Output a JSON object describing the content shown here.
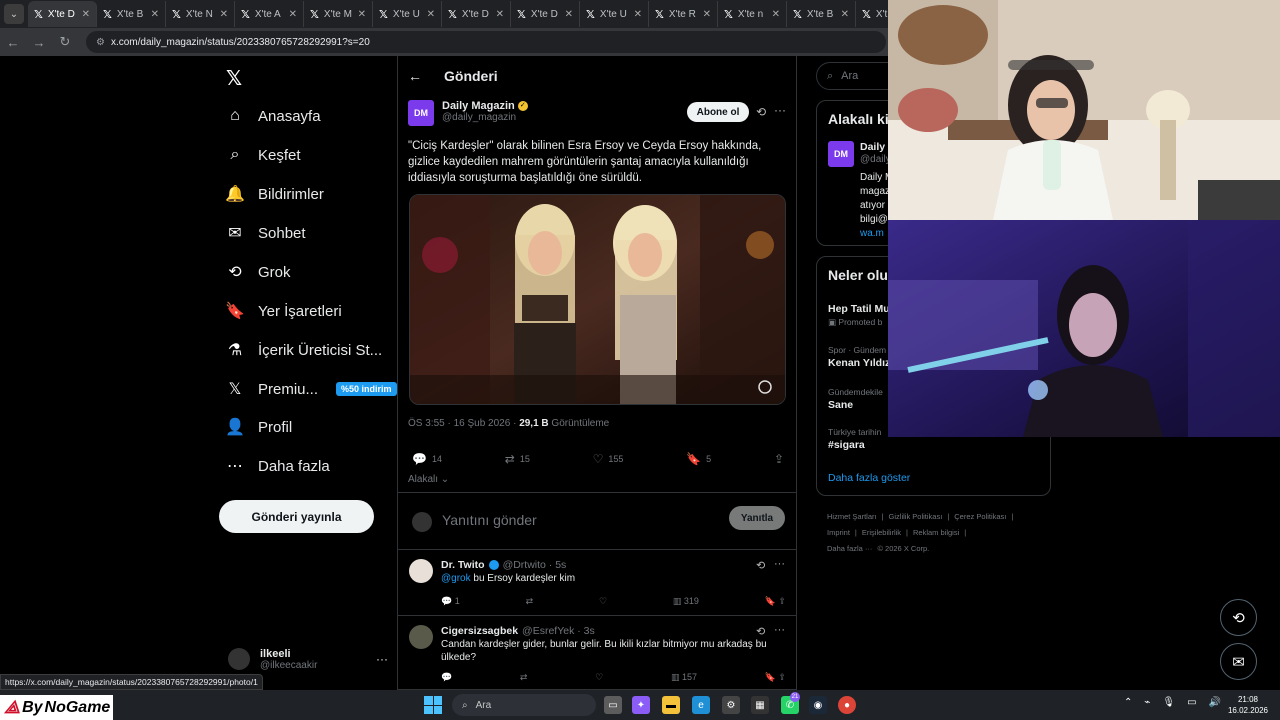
{
  "browser": {
    "tabs": [
      {
        "label": "X'te D",
        "active": true
      },
      {
        "label": "X'te B"
      },
      {
        "label": "X'te N"
      },
      {
        "label": "X'te A"
      },
      {
        "label": "X'te M"
      },
      {
        "label": "X'te U"
      },
      {
        "label": "X'te D"
      },
      {
        "label": "X'te D"
      },
      {
        "label": "X'te U"
      },
      {
        "label": "X'te R"
      },
      {
        "label": "X'te n"
      },
      {
        "label": "X'te B"
      },
      {
        "label": "X't"
      }
    ],
    "url": "x.com/daily_magazin/status/2023380765728292991?s=20",
    "status_url": "https://x.com/daily_magazin/status/2023380765728292991/photo/1"
  },
  "nav": {
    "items": [
      {
        "label": "Anasayfa",
        "icon": "home-icon"
      },
      {
        "label": "Keşfet",
        "icon": "search-icon"
      },
      {
        "label": "Bildirimler",
        "icon": "bell-icon"
      },
      {
        "label": "Sohbet",
        "icon": "mail-icon"
      },
      {
        "label": "Grok",
        "icon": "grok-icon"
      },
      {
        "label": "Yer İşaretleri",
        "icon": "bookmark-icon"
      },
      {
        "label": "İçerik Üreticisi St...",
        "icon": "creator-icon"
      },
      {
        "label": "Premiu...",
        "icon": "x-premium-icon"
      },
      {
        "label": "Profil",
        "icon": "person-icon"
      },
      {
        "label": "Daha fazla",
        "icon": "more-circle-icon"
      }
    ],
    "premium_badge": "%50 indirim",
    "post_button": "Gönderi yayınla",
    "account": {
      "name": "ilkeeli",
      "handle": "@ilkeecaakir"
    }
  },
  "post": {
    "header": "Gönderi",
    "author_name": "Daily Magazin",
    "author_handle": "@daily_magazin",
    "avatar_text": "DM",
    "follow_label": "Abone ol",
    "text": "\"Ciciş Kardeşler\" olarak bilinen Esra Ersoy ve Ceyda Ersoy hakkında, gizlice kaydedilen mahrem görüntülerin şantaj amacıyla kullanıldığı iddiasıyla soruşturma başlatıldığı öne sürüldü.",
    "time": "ÖS 3:55 · 16 Şub 2026 · ",
    "views": "29,1 B",
    "views_label": " Görüntüleme",
    "counts": {
      "replies": "14",
      "reposts": "15",
      "likes": "155",
      "bookmarks": "5"
    },
    "related_label": "Alakalı",
    "reply_placeholder": "Yanıtını gönder",
    "reply_button": "Yanıtla"
  },
  "replies": [
    {
      "name": "Dr. Twito",
      "handle": "@Drtwito · 5s",
      "mention": "@grok",
      "text": " bu Ersoy kardeşler kim",
      "replies": "1",
      "views": "319"
    },
    {
      "name": "Cigersizsagbek",
      "handle": "@EsrefYek · 3s",
      "mention": "",
      "text": "Candan kardeşler gider, bunlar gelir. Bu ikili kızlar bitmiyor mu arkadaş bu ülkede?",
      "replies": "",
      "views": "157"
    }
  ],
  "right": {
    "search_placeholder": "Ara",
    "related_title": "Alakalı ki",
    "related_name": "Daily I",
    "related_handle": "@daily",
    "related_bio_lines": [
      "Daily M",
      "magaz",
      "atıyor",
      "bilgi@"
    ],
    "related_link": "wa.m",
    "trends_title": "Neler olu",
    "trends": [
      {
        "category": "",
        "name": "Hep Tatil Mu",
        "promo": "Promoted b"
      },
      {
        "category": "Spor · Gündem",
        "name": "Kenan Yıldız",
        "promo": ""
      },
      {
        "category": "Gündemdekile",
        "name": "Sane",
        "promo": ""
      },
      {
        "category": "Türkiye tarihin",
        "name": "#sigara",
        "promo": ""
      }
    ],
    "show_more": "Daha fazla göster",
    "footer": [
      "Hizmet Şartları",
      "|",
      "Gizlilik Politikası",
      "|",
      "Çerez Politikası",
      "|",
      "Imprint",
      "|",
      "Erişilebilirlik",
      "|",
      "Reklam bilgisi",
      "|",
      "Daha fazla ···",
      "© 2026 X Corp."
    ]
  },
  "taskbar": {
    "brand_left": "By",
    "brand_right": "NoGame",
    "search": "Ara",
    "badge_whatsapp": "21",
    "time": "21:08",
    "date": "16.02.2026"
  },
  "colors": {
    "accent": "#1d9bf0",
    "verified_gold": "#f4c430",
    "background": "#000000",
    "border": "#2f3336"
  }
}
